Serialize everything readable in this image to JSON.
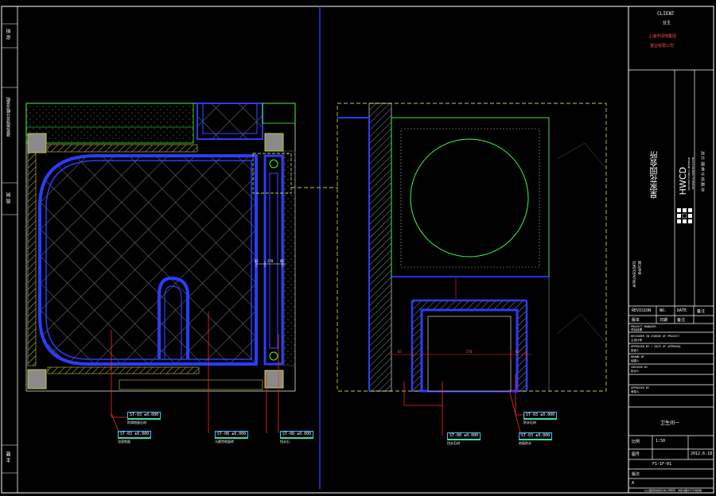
{
  "title_block": {
    "client_label": "CLIENT",
    "client_sub": "业主",
    "client_name_1": "上海市绿地集团",
    "client_name_2": "置业有限公司",
    "project_name": "皇家花园会所",
    "firm_logo": "HWCD",
    "firm_name_small_1": "ARCHITECTURE & INTERIOR",
    "firm_name_small_2": "DESIGN & CONSTRUCTION",
    "side_cn": "华 威 设 计 有 限 公 司",
    "revision_label": "REVISION",
    "revision_no": "NO.",
    "date_label": "DATE",
    "date_no": "备注",
    "rev_row_1": "版本",
    "rev_row_2": "日期",
    "rev_row_3": "备注",
    "section_rows": [
      "PROJECT MANAGER",
      "项目经理",
      "DESIGNER IN CHARGE OF PROJECT",
      "主设计师",
      "APPROVED BY / DATE OF APPROVAL",
      "批准人",
      "DRAWN BY",
      "绘图人",
      "CHECKED BY",
      "校对人",
      "APPROVED BY",
      "审批人"
    ],
    "drawing_title": "卫生间一",
    "scale_label": "比例",
    "scale_value": "1:50",
    "date_value": "2012.6.18",
    "drawing_no_label": "图号",
    "drawing_no_value": "F1-1F-01",
    "sheet_label": "版次",
    "sheet_value": "A",
    "footer": "以上图纸的版权归本公司所有，未经书面许可不得复制"
  },
  "left_frame_labels": [
    "说  明",
    "建筑装饰设计概况说明",
    "图  例",
    "主  要"
  ],
  "approval_stamp": {
    "line1": "APPROVED/DATE",
    "line2": "审批/日期"
  },
  "plan_tags": [
    {
      "code": "ST-03",
      "value": "±0.000",
      "desc": "防滑地面石材"
    },
    {
      "code": "ST-03",
      "value": "±0.000",
      "desc": "浴室地面"
    },
    {
      "code": "ST-08",
      "value": "±0.000",
      "desc": "马赛克地面砖"
    },
    {
      "code": "ST-08",
      "value": "±0.000",
      "desc": "挡水石"
    }
  ],
  "detail_tags": [
    {
      "code": "ST-03",
      "value": "±0.000",
      "desc": "防水石材"
    },
    {
      "code": "ST-08",
      "value": "±0.000",
      "desc": "挡水石材"
    },
    {
      "code": "ST-03",
      "value": "±0.000",
      "desc": "地面防水"
    }
  ],
  "dimensions": {
    "left": "65",
    "mid": "270",
    "right": "65",
    "plan_1": "65",
    "plan_2": "270",
    "plan_3": "65"
  },
  "colors": {
    "wall": "#2b3cff",
    "hatch": "#c8c844",
    "green": "#3cff3c",
    "red": "#ff2a2a",
    "cyan": "#3ec0ff",
    "frame": "#ffffff"
  }
}
